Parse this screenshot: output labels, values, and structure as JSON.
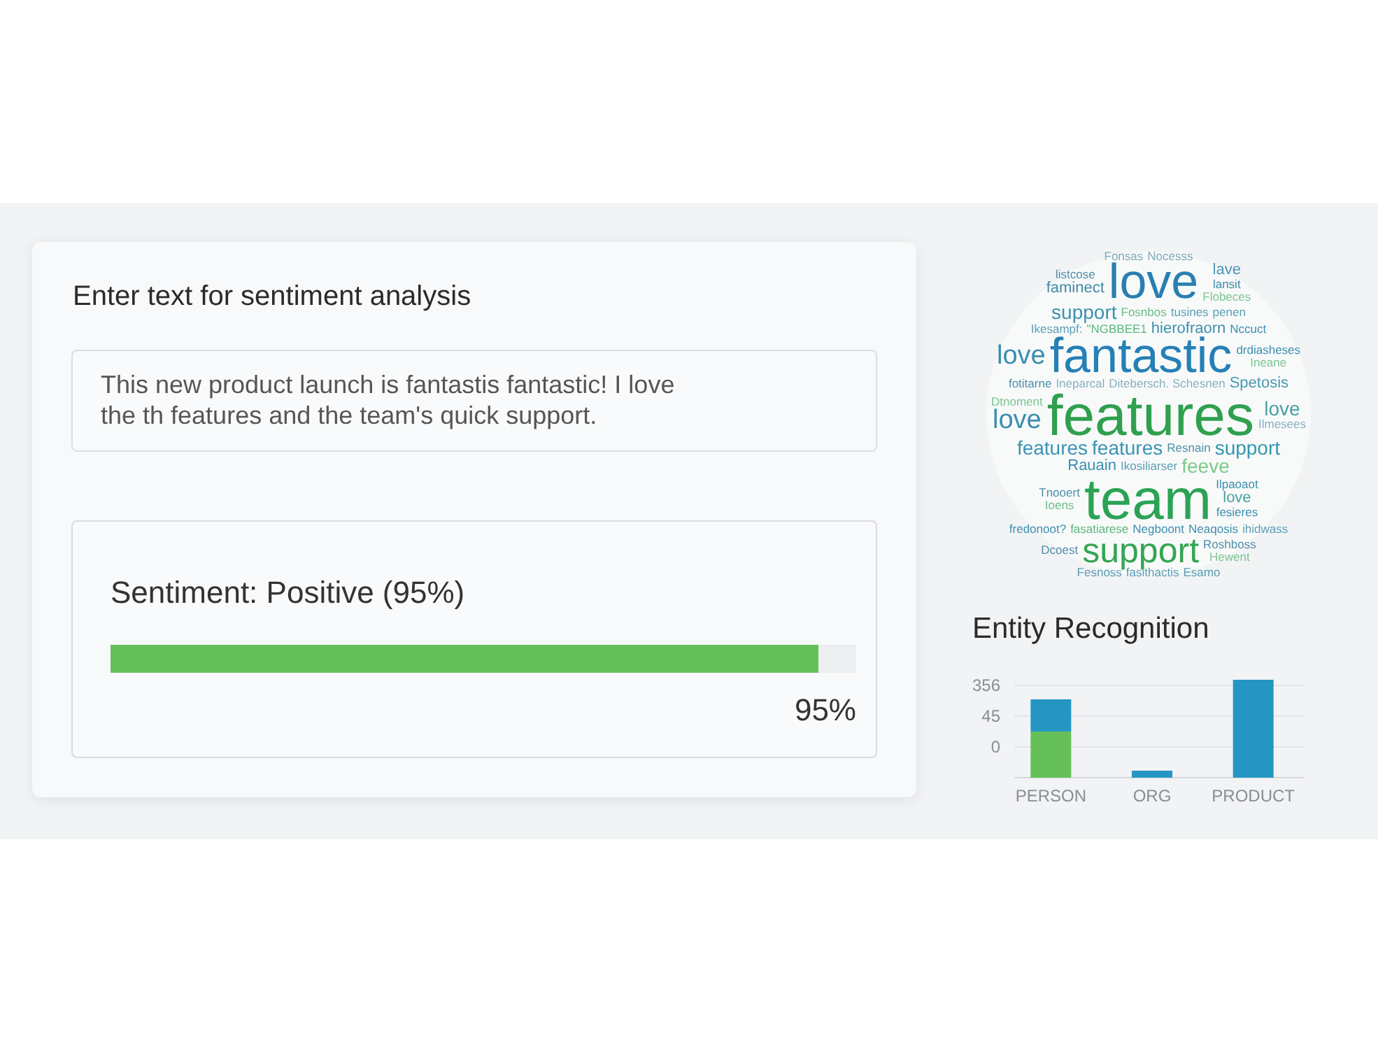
{
  "input": {
    "heading": "Enter text for sentiment analysis",
    "value": "This new product launch is fantastis fantastic! I love the th features and the team's quick support."
  },
  "result": {
    "label": "Sentiment: Positive (95%)",
    "level": 0.95,
    "reading": "95%"
  },
  "word_cloud": {
    "rows": [
      [
        {
          "text": "Fonsas",
          "kind": "tiny",
          "color": "#7fa9b8"
        },
        {
          "text": "Nocesss",
          "kind": "tiny",
          "color": "#7fa9b8"
        }
      ],
      [
        {
          "kind": "stack",
          "words": [
            {
              "text": "listcose",
              "kind": "tiny",
              "color": "#4f8fa8"
            },
            {
              "text": "faminect",
              "kind": "minor",
              "color": "#3f8aa5"
            }
          ]
        },
        {
          "text": "love",
          "kind": "large",
          "color": "#2a7fb0"
        },
        {
          "kind": "stack",
          "words": [
            {
              "text": "lave",
              "kind": "minor",
              "color": "#4b95b5"
            },
            {
              "text": "lansit",
              "kind": "tiny",
              "color": "#3f8aa5"
            },
            {
              "text": "Flobeces",
              "kind": "tiny",
              "color": "#7cc493"
            }
          ]
        }
      ],
      [
        {
          "text": "support",
          "kind": "small",
          "color": "#3a93ad"
        },
        {
          "text": "Fosnbos",
          "kind": "tiny",
          "color": "#6cbf86"
        },
        {
          "text": "tusines",
          "kind": "tiny",
          "color": "#5b9fb5"
        },
        {
          "text": "penen",
          "kind": "tiny",
          "color": "#5b9fb5"
        }
      ],
      [
        {
          "text": "Ikesampf:",
          "kind": "tiny",
          "color": "#5b9fb5"
        },
        {
          "text": "\"NGBBEE1",
          "kind": "tiny",
          "color": "#5db77d"
        },
        {
          "text": "hierofraorn",
          "kind": "minor",
          "color": "#3d8fae"
        },
        {
          "text": "Nccuct",
          "kind": "tiny",
          "color": "#3d8fae"
        }
      ],
      [
        {
          "text": "love",
          "kind": "medium",
          "color": "#3a8db0"
        },
        {
          "text": "fantastic",
          "kind": "large",
          "color": "#2580b5"
        },
        {
          "kind": "stack",
          "words": [
            {
              "text": "drdiasheses",
              "kind": "tiny",
              "color": "#3d8fae"
            },
            {
              "text": "Ineane",
              "kind": "tiny",
              "color": "#7cc493"
            }
          ]
        }
      ],
      [
        {
          "text": "fotitarne",
          "kind": "tiny",
          "color": "#4f8fa8"
        },
        {
          "text": "Ineparcal",
          "kind": "tiny",
          "color": "#8ab0c0"
        },
        {
          "text": "Ditebersch. Schesnen",
          "kind": "tiny",
          "color": "#8ab0c0"
        },
        {
          "text": "Spetosis",
          "kind": "minor",
          "color": "#4a9ab0"
        }
      ],
      [
        {
          "kind": "stack",
          "words": [
            {
              "text": "Dtnoment",
              "kind": "tiny",
              "color": "#7cc493"
            },
            {
              "text": "love",
              "kind": "medium",
              "color": "#3a8db0"
            }
          ]
        },
        {
          "text": "features",
          "kind": "huge",
          "color": "#2fa04e"
        },
        {
          "kind": "stack",
          "words": [
            {
              "text": "love",
              "kind": "small",
              "color": "#4ba0a0"
            },
            {
              "text": "Ilmesees",
              "kind": "tiny",
              "color": "#8ab0c0"
            }
          ]
        }
      ],
      [
        {
          "text": "features",
          "kind": "small",
          "color": "#3a94b5"
        },
        {
          "text": "features",
          "kind": "small",
          "color": "#3a94b5"
        },
        {
          "text": "Resnain",
          "kind": "tiny",
          "color": "#4f8fa8"
        },
        {
          "text": "support",
          "kind": "small",
          "color": "#3498b0"
        }
      ],
      [
        {
          "text": "Rauain",
          "kind": "minor",
          "color": "#3a8db0"
        },
        {
          "text": "Ikosiliarser",
          "kind": "tiny",
          "color": "#5b9fb5"
        },
        {
          "text": "feeve",
          "kind": "small",
          "color": "#7cc98a"
        }
      ],
      [
        {
          "kind": "stack",
          "words": [
            {
              "text": "Tnooert",
              "kind": "tiny",
              "color": "#4f8fa8"
            },
            {
              "text": "Ioens",
              "kind": "tiny",
              "color": "#6cbf86"
            }
          ]
        },
        {
          "text": "team",
          "kind": "huge",
          "color": "#2aa355"
        },
        {
          "kind": "stack",
          "words": [
            {
              "text": "Ilpaoaot",
              "kind": "tiny",
              "color": "#3d8fae"
            },
            {
              "text": "love",
              "kind": "minor",
              "color": "#4ba0a0"
            },
            {
              "text": "fesieres",
              "kind": "tiny",
              "color": "#3d8fae"
            }
          ]
        }
      ],
      [
        {
          "text": "fredonoot?",
          "kind": "tiny",
          "color": "#3d8fae"
        },
        {
          "text": "fasatiarese",
          "kind": "tiny",
          "color": "#5db77d"
        },
        {
          "text": "Negboont",
          "kind": "tiny",
          "color": "#3d8fae"
        },
        {
          "text": "Neaqosis",
          "kind": "tiny",
          "color": "#3d8fae"
        },
        {
          "text": "ihidwass",
          "kind": "tiny",
          "color": "#5b9fb5"
        }
      ],
      [
        {
          "text": "Dcoest",
          "kind": "tiny",
          "color": "#4f8fa8"
        },
        {
          "text": "support",
          "kind": "big",
          "color": "#35a552"
        },
        {
          "kind": "stack",
          "words": [
            {
              "text": "Roshboss",
              "kind": "tiny",
              "color": "#4f8fa8"
            },
            {
              "text": "Hewent",
              "kind": "tiny",
              "color": "#7cc493"
            }
          ]
        }
      ],
      [
        {
          "text": "Fesnoss",
          "kind": "tiny",
          "color": "#5b9fb5"
        },
        {
          "text": "fasithactis",
          "kind": "tiny",
          "color": "#5b9fb5"
        },
        {
          "text": "Esamo",
          "kind": "tiny",
          "color": "#5b9fb5"
        }
      ]
    ]
  },
  "entity_chart": {
    "title": "Entity Recognition",
    "axis_labels": [
      "356",
      "45",
      "0"
    ],
    "categories": [
      "PERSON",
      "ORG",
      "PRODUCT"
    ]
  }
}
